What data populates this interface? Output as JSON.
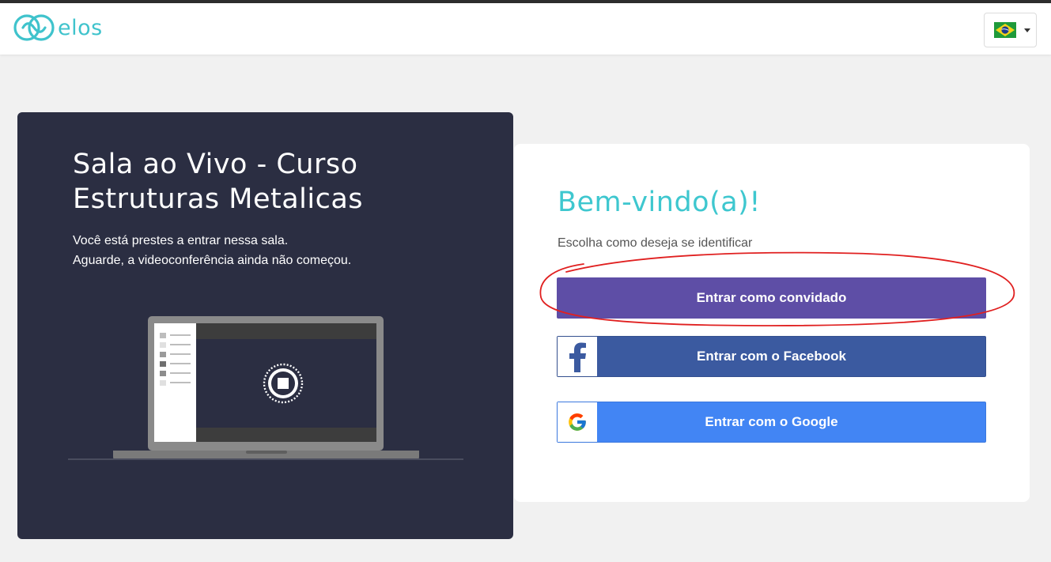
{
  "header": {
    "logo_text": "elos",
    "language": {
      "selected": "Português (Brasil)",
      "flag_icon": "brazil-flag-icon"
    }
  },
  "room": {
    "title": "Sala ao Vivo - Curso Estruturas Metalicas",
    "message_line1": "Você está prestes a entrar nessa sala.",
    "message_line2": "Aguarde, a videoconferência ainda não começou."
  },
  "login": {
    "welcome": "Bem-vindo(a)!",
    "prompt": "Escolha como deseja se identificar",
    "guest_label": "Entrar como convidado",
    "facebook_label": "Entrar com o Facebook",
    "google_label": "Entrar com o Google"
  },
  "colors": {
    "brand_teal": "#3ec7cf",
    "panel_dark": "#2b2e42",
    "guest_button": "#5e4ea6",
    "facebook_button": "#3b5aa0",
    "google_button": "#4285f4",
    "annotation_red": "#e02020"
  },
  "icons": [
    "elos-logo-icon",
    "brazil-flag-icon",
    "chevron-down-icon",
    "laptop-illustration",
    "stop-icon",
    "facebook-icon",
    "google-icon"
  ]
}
